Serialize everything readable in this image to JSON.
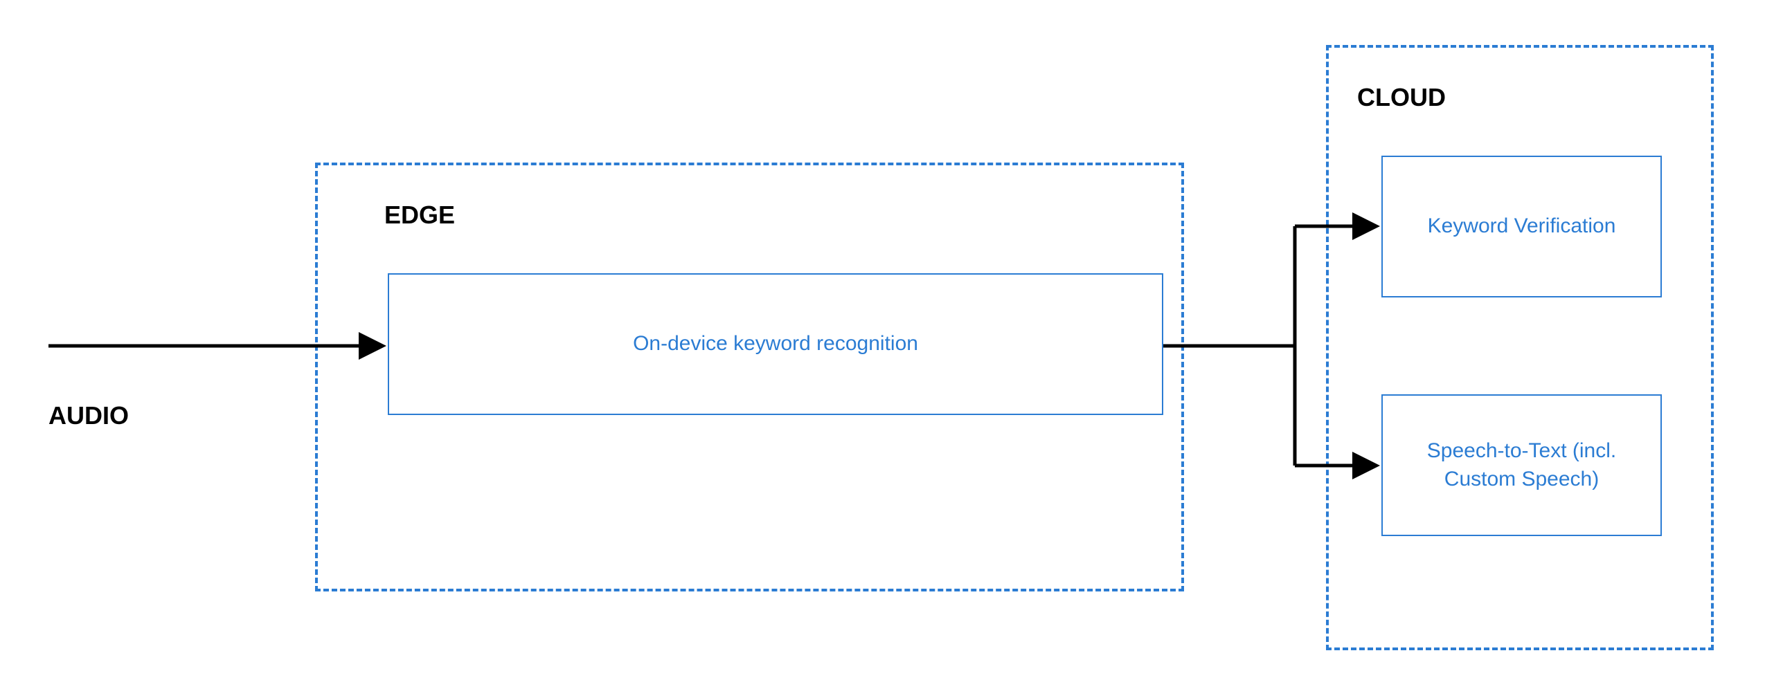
{
  "diagram": {
    "audio_label": "AUDIO",
    "edge": {
      "title": "EDGE",
      "box1": "On-device keyword recognition"
    },
    "cloud": {
      "title": "CLOUD",
      "box1": "Keyword Verification",
      "box2": "Speech-to-Text (incl. Custom Speech)"
    }
  },
  "chart_data": {
    "type": "flow-diagram",
    "nodes": [
      {
        "id": "audio",
        "label": "AUDIO",
        "kind": "source"
      },
      {
        "id": "edge",
        "label": "EDGE",
        "kind": "container",
        "children": [
          "on_device_kr"
        ]
      },
      {
        "id": "on_device_kr",
        "label": "On-device keyword recognition",
        "kind": "process"
      },
      {
        "id": "cloud",
        "label": "CLOUD",
        "kind": "container",
        "children": [
          "kw_verification",
          "stt"
        ]
      },
      {
        "id": "kw_verification",
        "label": "Keyword Verification",
        "kind": "process"
      },
      {
        "id": "stt",
        "label": "Speech-to-Text (incl. Custom Speech)",
        "kind": "process"
      }
    ],
    "edges": [
      {
        "from": "audio",
        "to": "on_device_kr"
      },
      {
        "from": "on_device_kr",
        "to": "kw_verification"
      },
      {
        "from": "on_device_kr",
        "to": "stt"
      }
    ]
  }
}
